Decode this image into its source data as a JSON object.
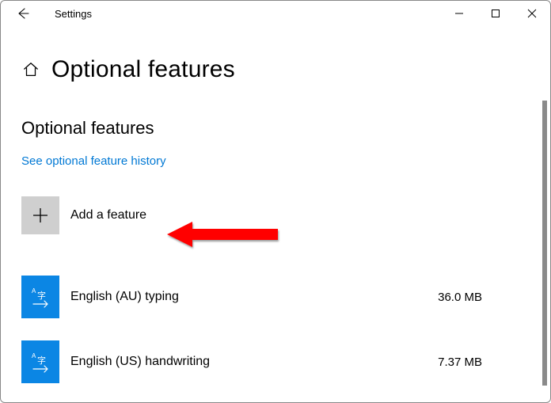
{
  "titlebar": {
    "title": "Settings"
  },
  "page": {
    "title": "Optional features"
  },
  "section": {
    "title": "Optional features"
  },
  "links": {
    "history": "See optional feature history"
  },
  "add": {
    "label": "Add a feature"
  },
  "features": [
    {
      "name": "English (AU) typing",
      "size": "36.0 MB",
      "icon": "language-icon"
    },
    {
      "name": "English (US) handwriting",
      "size": "7.37 MB",
      "icon": "language-icon"
    }
  ],
  "colors": {
    "accent": "#0078d4",
    "tile_blue": "#0b86e4",
    "add_tile": "#cfcfcf",
    "arrow": "#ff0000"
  }
}
